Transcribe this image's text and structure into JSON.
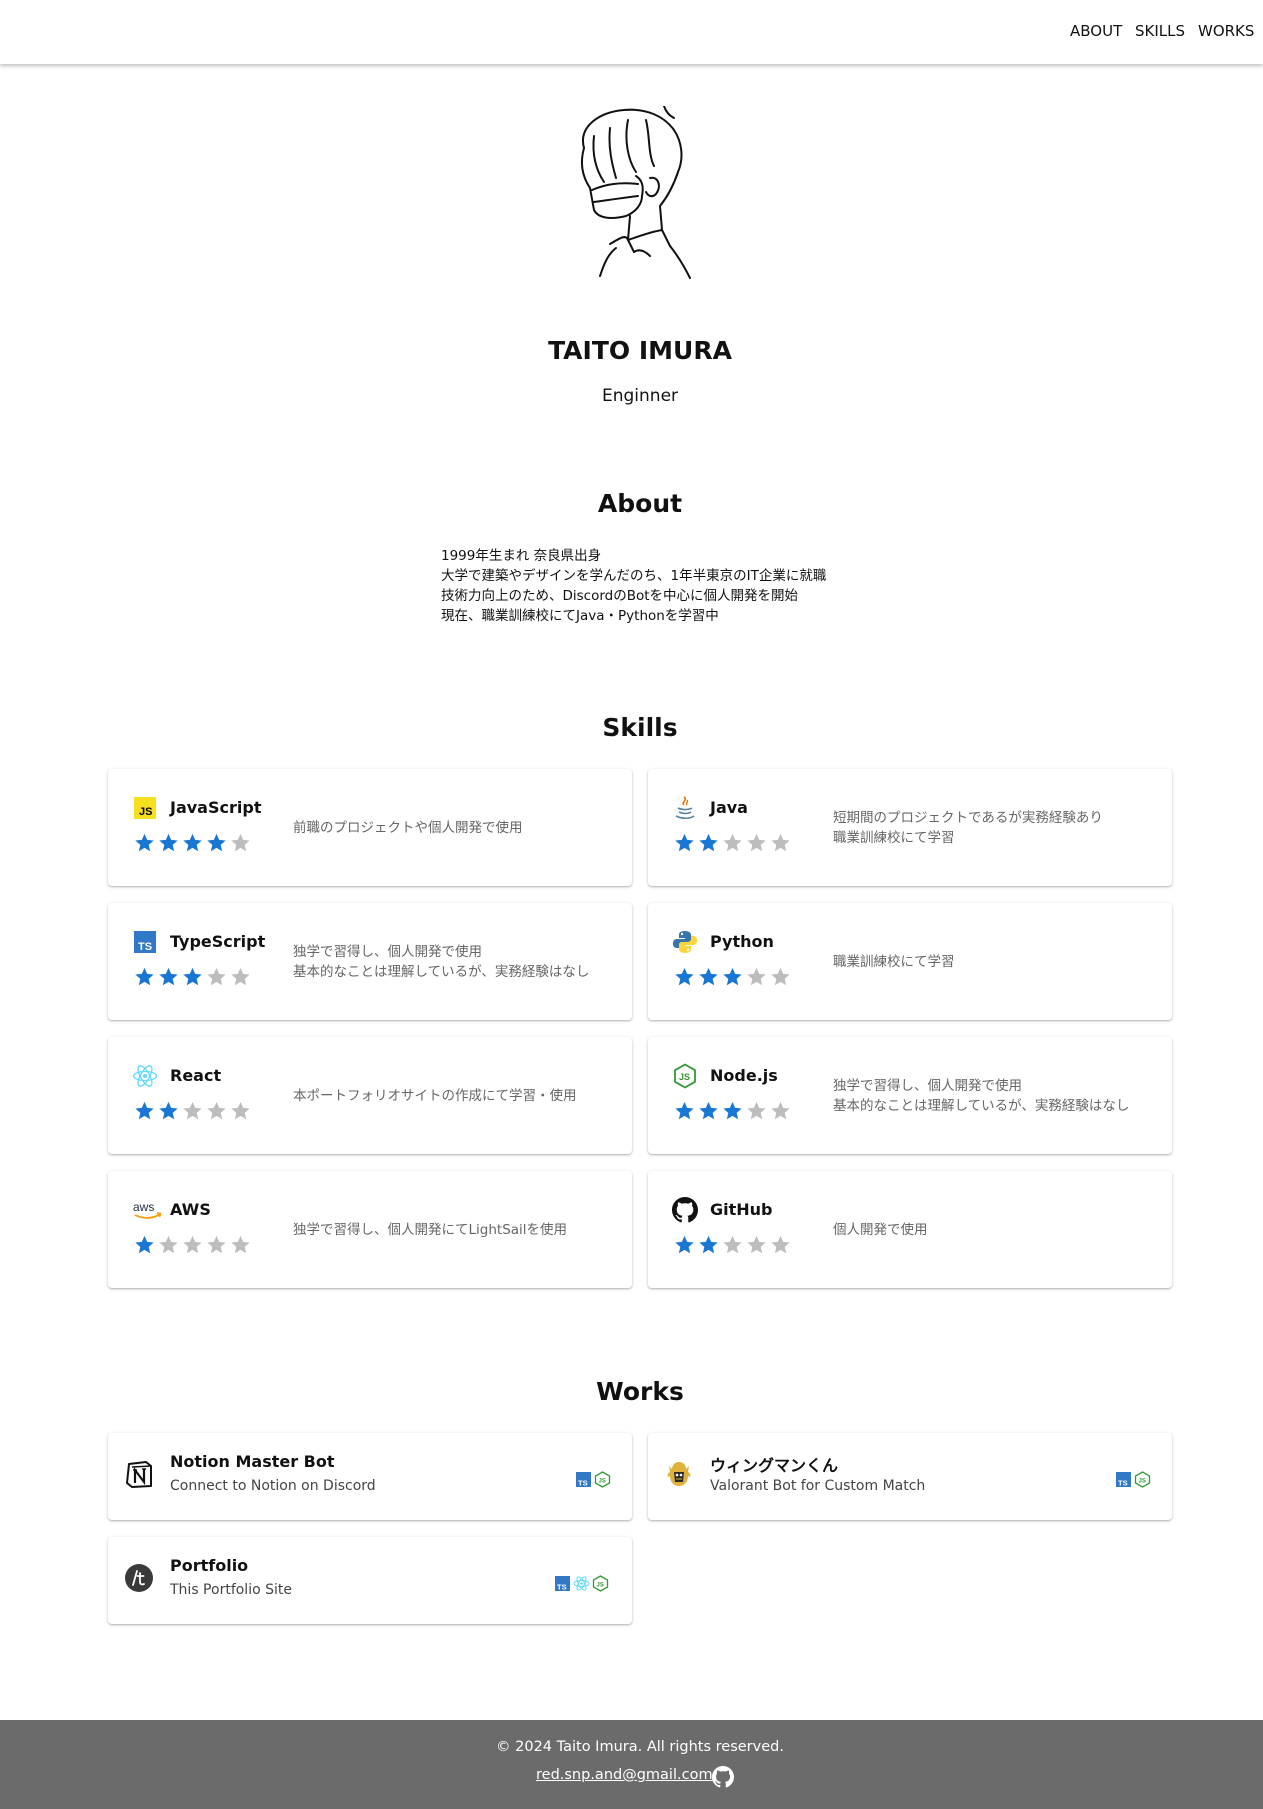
{
  "nav": {
    "about": "ABOUT",
    "skills": "SKILLS",
    "works": "WORKS"
  },
  "profile": {
    "name": "TAITO IMURA",
    "role": "Enginner"
  },
  "about": {
    "title": "About",
    "lines": [
      "1999年生まれ 奈良県出身",
      "大学で建築やデザインを学んだのち、1年半東京のIT企業に就職",
      "技術力向上のため、DiscordのBotを中心に個人開発を開始",
      "現在、職業訓練校にてJava・Pythonを学習中"
    ]
  },
  "skills": {
    "title": "Skills",
    "items": [
      {
        "name": "JavaScript",
        "icon": "javascript-icon",
        "rating": 4,
        "max": 5,
        "desc": [
          "前職のプロジェクトや個人開発で使用"
        ]
      },
      {
        "name": "Java",
        "icon": "java-icon",
        "rating": 2,
        "max": 5,
        "desc": [
          "短期間のプロジェクトであるが実務経験あり",
          "職業訓練校にて学習"
        ]
      },
      {
        "name": "TypeScript",
        "icon": "typescript-icon",
        "rating": 3,
        "max": 5,
        "desc": [
          "独学で習得し、個人開発で使用",
          "基本的なことは理解しているが、実務経験はなし"
        ]
      },
      {
        "name": "Python",
        "icon": "python-icon",
        "rating": 3,
        "max": 5,
        "desc": [
          "職業訓練校にて学習"
        ]
      },
      {
        "name": "React",
        "icon": "react-icon",
        "rating": 2,
        "max": 5,
        "desc": [
          "本ポートフォリオサイトの作成にて学習・使用"
        ]
      },
      {
        "name": "Node.js",
        "icon": "nodejs-icon",
        "rating": 3,
        "max": 5,
        "desc": [
          "独学で習得し、個人開発で使用",
          "基本的なことは理解しているが、実務経験はなし"
        ]
      },
      {
        "name": "AWS",
        "icon": "aws-icon",
        "rating": 1,
        "max": 5,
        "desc": [
          "独学で習得し、個人開発にてLightSailを使用"
        ]
      },
      {
        "name": "GitHub",
        "icon": "github-icon",
        "rating": 2,
        "max": 5,
        "desc": [
          "個人開発で使用"
        ]
      }
    ]
  },
  "works": {
    "title": "Works",
    "items": [
      {
        "title": "Notion Master Bot",
        "subtitle": "Connect to Notion on Discord",
        "icon": "notion-icon",
        "tech": [
          "typescript-icon",
          "nodejs-icon"
        ]
      },
      {
        "title": "ウィングマンくん",
        "subtitle": "Valorant Bot for Custom Match",
        "icon": "wingman-icon",
        "tech": [
          "typescript-icon",
          "nodejs-icon"
        ]
      },
      {
        "title": "Portfolio",
        "subtitle": "This Portfolio Site",
        "icon": "portfolio-logo-icon",
        "tech": [
          "typescript-icon",
          "react-icon",
          "nodejs-icon"
        ]
      }
    ]
  },
  "footer": {
    "copyright": "© 2024 Taito Imura. All rights reserved.",
    "email": "red.snp.and@gmail.com",
    "github_icon": "github-icon"
  },
  "colors": {
    "star_filled": "#1976d2",
    "star_empty": "#bdbdbd",
    "footer_bg": "#6b6b6b"
  }
}
